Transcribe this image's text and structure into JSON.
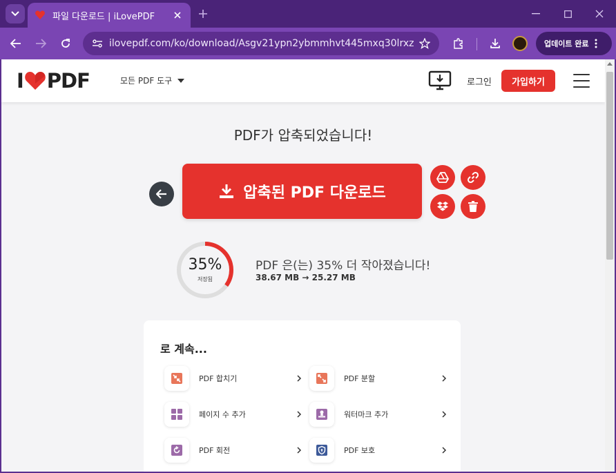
{
  "browser": {
    "tab_title": "파일 다운로드 | iLovePDF",
    "url": "ilovepdf.com/ko/download/Asgv21ypn2ybmmhvt445mxq30lrxzy47c...",
    "update_label": "업데이트 완료"
  },
  "header": {
    "logo_left": "I",
    "logo_right": "PDF",
    "tools_menu": "모든 PDF 도구",
    "login": "로그인",
    "signup": "가입하기"
  },
  "main": {
    "headline": "PDF가 압축되었습니다!",
    "download_label": "압축된 PDF 다운로드",
    "saved_percent": "35%",
    "saved_label": "저장됨",
    "saved_fraction": 0.35,
    "result_text": "PDF 은(는) 35% 더 작아졌습니다!",
    "size_before": "38.67 MB",
    "size_after": "25.27 MB"
  },
  "continue": {
    "title": "로 계속...",
    "items": [
      {
        "label": "PDF 합치기",
        "icon": "merge-pdf-icon"
      },
      {
        "label": "PDF 분할",
        "icon": "split-pdf-icon"
      },
      {
        "label": "페이지 수 추가",
        "icon": "page-numbers-icon"
      },
      {
        "label": "워터마크 추가",
        "icon": "watermark-icon"
      },
      {
        "label": "PDF 회전",
        "icon": "rotate-pdf-icon"
      },
      {
        "label": "PDF 보호",
        "icon": "protect-pdf-icon"
      }
    ]
  },
  "colors": {
    "brand_red": "#e5322d",
    "browser_purple": "#7a45b3",
    "tab_bar": "#4a2378"
  }
}
